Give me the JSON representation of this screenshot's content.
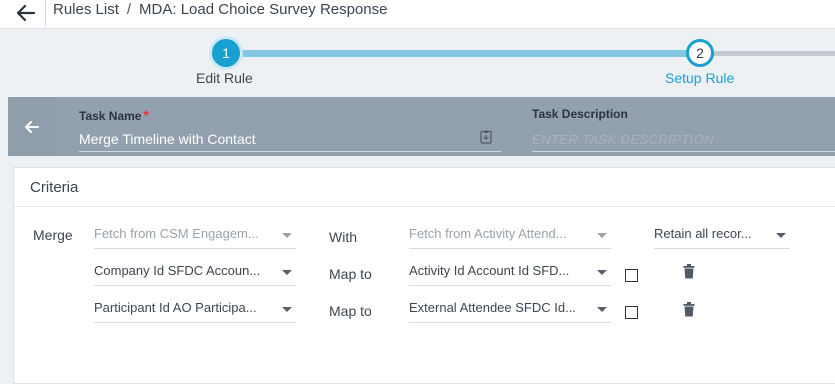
{
  "header": {
    "back_icon": "arrow-left-icon",
    "breadcrumb_root": "Rules List",
    "breadcrumb_separator": "/",
    "breadcrumb_current": "MDA: Load Choice Survey Response"
  },
  "stepper": {
    "steps": [
      {
        "number": "1",
        "label": "Edit Rule",
        "state": "completed"
      },
      {
        "number": "2",
        "label": "Setup Rule",
        "state": "active"
      }
    ],
    "accent_color": "#17a0d0"
  },
  "task": {
    "back_icon": "arrow-left-icon",
    "name_label": "Task Name",
    "required_mark": "*",
    "name_value": "Merge Timeline with Contact",
    "name_icon": "clipboard-icon",
    "description_label": "Task Description",
    "description_placeholder": "ENTER TASK DESCRIPTION"
  },
  "criteria": {
    "title": "Criteria",
    "merge_label": "Merge",
    "merge_left": "Fetch from CSM Engagem...",
    "with_label": "With",
    "merge_right": "Fetch from Activity Attend...",
    "retain": "Retain all recor...",
    "mappings": [
      {
        "left": "Company Id SFDC Accoun...",
        "map_label": "Map to",
        "right": "Activity Id Account Id SFD...",
        "checked": false,
        "delete_icon": "trash-icon"
      },
      {
        "left": "Participant Id AO Participa...",
        "map_label": "Map to",
        "right": "External Attendee SFDC Id...",
        "checked": false,
        "delete_icon": "trash-icon"
      }
    ]
  }
}
